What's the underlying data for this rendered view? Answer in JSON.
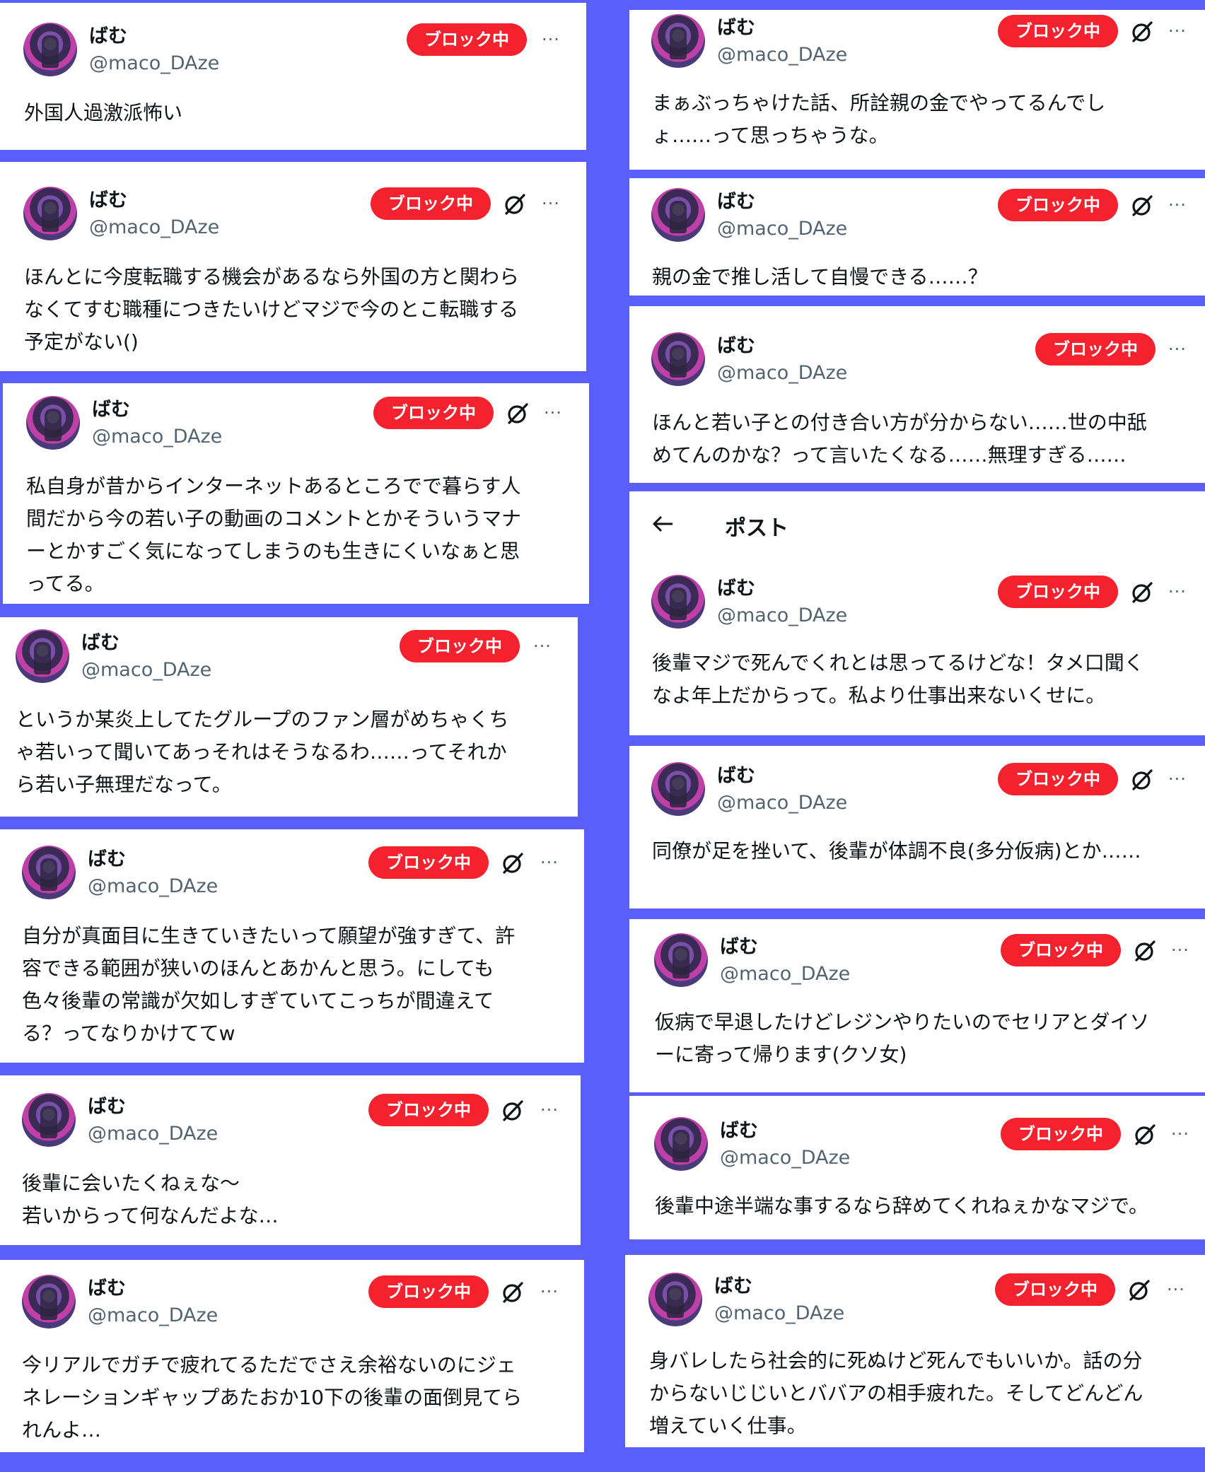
{
  "user": {
    "name": "ばむ",
    "handle": "@maco_DAze"
  },
  "badge_label": "ブロック中",
  "more_label": "···",
  "header": {
    "back_icon": "arrow-left-icon",
    "title": "ポスト"
  },
  "colors": {
    "background": "#5a5efb",
    "badge": "#f4212e",
    "text": "#0f1419",
    "muted": "#536471"
  },
  "posts": [
    {
      "text": "外国人過激派怖い"
    },
    {
      "text": "ほんとに今度転職する機会があるなら外国の方と関わら\nなくてすむ職種につきたいけどマジで今のとこ転職する\n予定がない()"
    },
    {
      "text": "私自身が昔からインターネットあるところでで暮らす人\n間だから今の若い子の動画のコメントとかそういうマナ\nーとかすごく気になってしまうのも生きにくいなぁと思\nってる。"
    },
    {
      "text": "というか某炎上してたグループのファン層がめちゃくち\nゃ若いって聞いてあっそれはそうなるわ……ってそれか\nら若い子無理だなって。"
    },
    {
      "text": "自分が真面目に生きていきたいって願望が強すぎて、許\n容できる範囲が狭いのほんとあかんと思う。にしても\n色々後輩の常識が欠如しすぎていてこっちが間違えて\nる？ってなりかけててw"
    },
    {
      "text": "後輩に会いたくねぇな〜\n若いからって何なんだよな…"
    },
    {
      "text": "今リアルでガチで疲れてるただでさえ余裕ないのにジェ\nネレーションギャップあたおか10下の後輩の面倒見てら\nれんよ…"
    },
    {
      "text": "まぁぶっちゃけた話、所詮親の金でやってるんでし\nょ……って思っちゃうな。"
    },
    {
      "text": "親の金で推し活して自慢できる……？"
    },
    {
      "text": "ほんと若い子との付き合い方が分からない……世の中舐\nめてんのかな？って言いたくなる……無理すぎる……"
    },
    {
      "text": "後輩マジで死んでくれとは思ってるけどな！タメ口聞く\nなよ年上だからって。私より仕事出来ないくせに。"
    },
    {
      "text": "同僚が足を挫いて、後輩が体調不良(多分仮病)とか……"
    },
    {
      "text": "仮病で早退したけどレジンやりたいのでセリアとダイソ\nーに寄って帰ります(クソ女)"
    },
    {
      "text": "後輩中途半端な事するなら辞めてくれねぇかなマジで。"
    },
    {
      "text": "身バレしたら社会的に死ぬけど死んでもいいか。話の分\nからないじじいとババアの相手疲れた。そしてどんどん\n増えていく仕事。"
    }
  ]
}
